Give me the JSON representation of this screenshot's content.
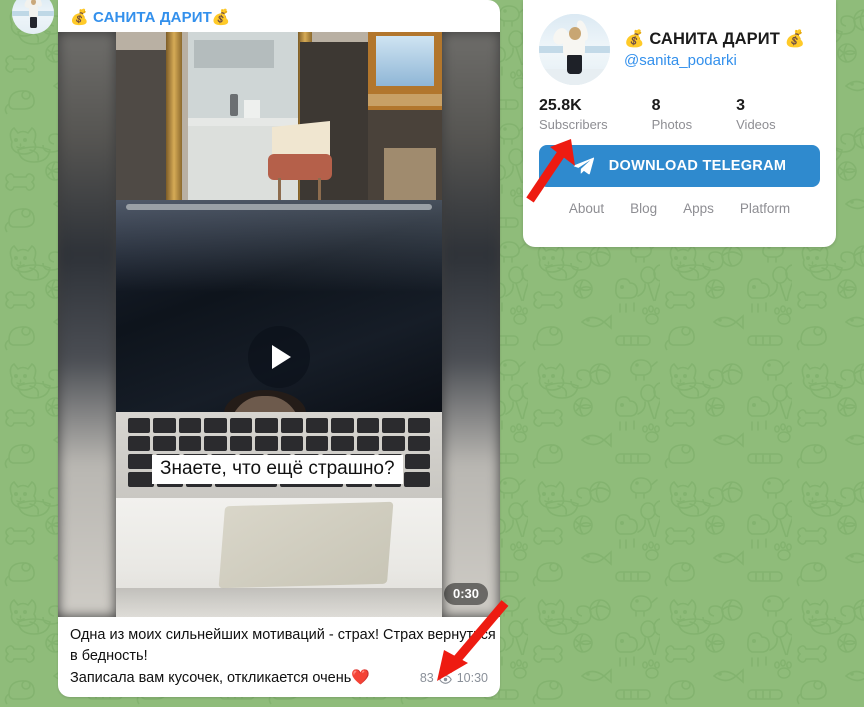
{
  "wallpaper": {
    "base_color": "#8fbc7a",
    "doodle_color": "#7fae6a",
    "theme": "cats-and-dogs-doodles"
  },
  "message": {
    "author": "💰 САНИТА ДАРИТ💰",
    "video": {
      "subtitle": "Знаете, что ещё страшно?",
      "duration": "0:30",
      "play_icon": "play-icon"
    },
    "caption_lines": [
      "Одна из моих сильнейших мотиваций - страх! Страх вернуться",
      "в бедность!",
      "Записала вам кусочек, откликается очень"
    ],
    "caption_emoji": "❤️",
    "views": "83",
    "views_icon": "eye-icon",
    "time": "10:30"
  },
  "profile": {
    "title": "💰 САНИТА ДАРИТ 💰",
    "username": "@sanita_podarki",
    "avatar_name": "channel-avatar",
    "stats": [
      {
        "value": "25.8K",
        "label": "Subscribers"
      },
      {
        "value": "8",
        "label": "Photos"
      },
      {
        "value": "3",
        "label": "Videos"
      }
    ],
    "download_button": {
      "label": "DOWNLOAD TELEGRAM",
      "icon": "telegram-plane-icon",
      "color": "#2f8ace"
    },
    "links": [
      "About",
      "Blog",
      "Apps",
      "Platform"
    ]
  },
  "annotations": {
    "color": "#ee1b11",
    "arrows": [
      {
        "name": "arrow-to-subscribers",
        "target": "Subscribers"
      },
      {
        "name": "arrow-to-view-count",
        "target": "83"
      }
    ]
  }
}
